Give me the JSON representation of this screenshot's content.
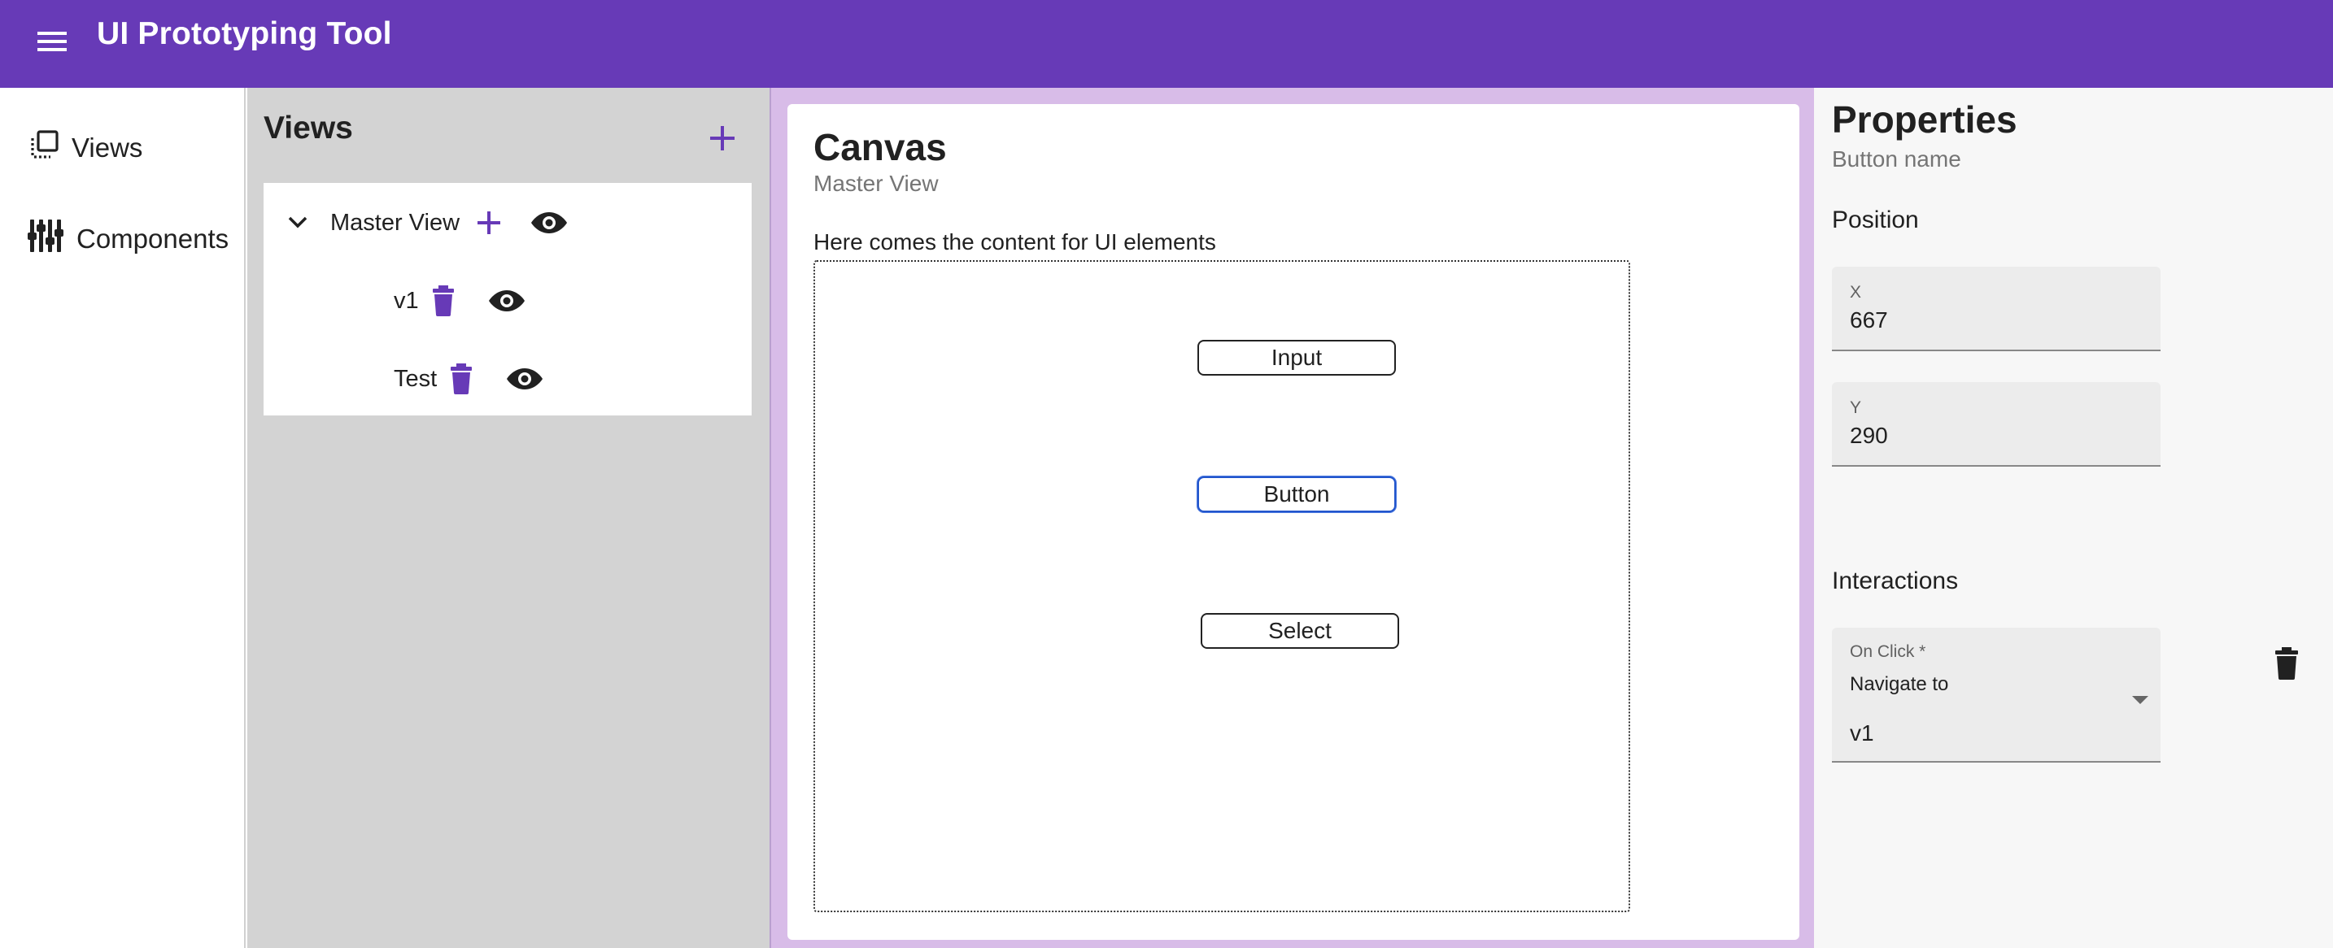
{
  "app": {
    "title": "UI Prototyping Tool",
    "brand_color": "#673ab7"
  },
  "nav": {
    "items": [
      {
        "label": "Views",
        "icon": "views-icon"
      },
      {
        "label": "Components",
        "icon": "components-icon"
      }
    ]
  },
  "views_panel": {
    "title": "Views",
    "tree": {
      "root": {
        "label": "Master View",
        "expanded": true
      },
      "children": [
        {
          "label": "v1"
        },
        {
          "label": "Test"
        }
      ]
    }
  },
  "canvas": {
    "title": "Canvas",
    "subtitle": "Master View",
    "description": "Here comes the content for UI elements",
    "elements": [
      {
        "label": "Input",
        "selected": false
      },
      {
        "label": "Button",
        "selected": true
      },
      {
        "label": "Select",
        "selected": false
      }
    ]
  },
  "properties": {
    "title": "Properties",
    "subtitle": "Button name",
    "position_label": "Position",
    "x_label": "X",
    "x_value": "667",
    "y_label": "Y",
    "y_value": "290",
    "interactions_label": "Interactions",
    "onclick_label": "On Click *",
    "onclick_action": "Navigate to",
    "onclick_target": "v1"
  }
}
